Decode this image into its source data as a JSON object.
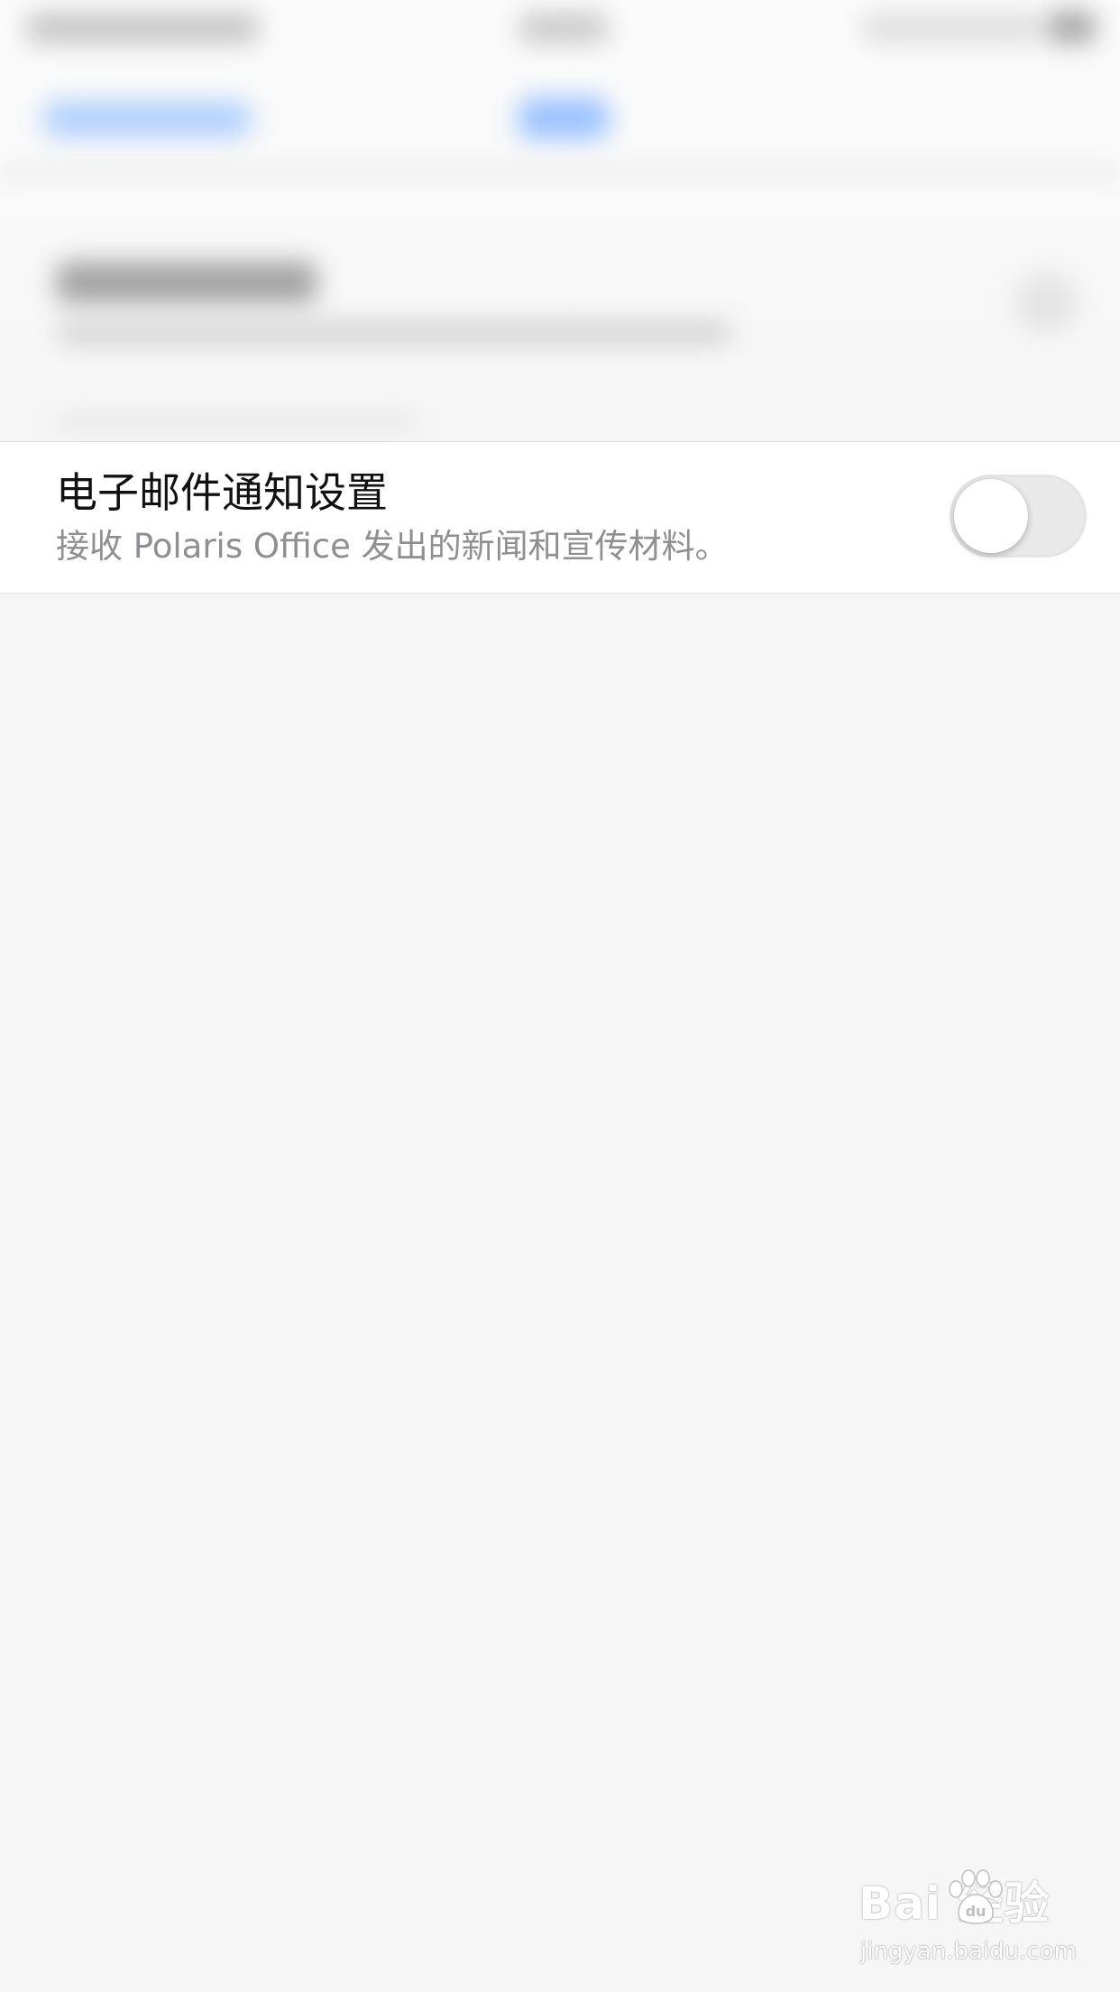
{
  "email_notification": {
    "title": "电子邮件通知设置",
    "description": "接收 Polaris Office 发出的新闻和宣传材料。",
    "toggle_state": "off"
  },
  "watermark": {
    "logo_text": "Bai  经验",
    "url": "jingyan.baidu.com"
  },
  "colors": {
    "background": "#f6f6f6",
    "row_background": "#ffffff",
    "title_text": "#111111",
    "description_text": "#8e8e93",
    "toggle_off_track": "#e9e9ea"
  },
  "icons": {
    "toggle": "switch-toggle-off",
    "watermark_logo": "baidu-paw-icon"
  }
}
